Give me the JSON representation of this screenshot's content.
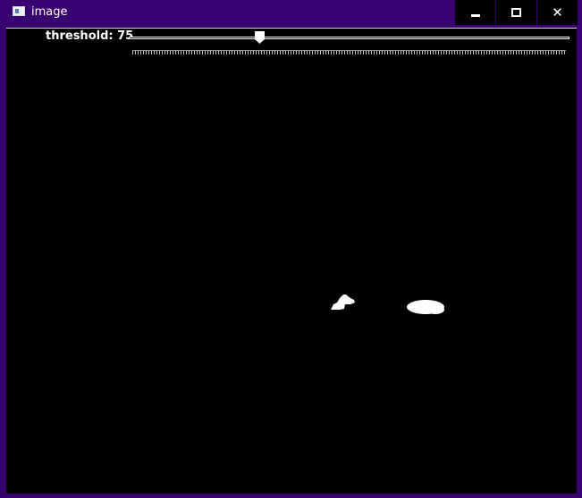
{
  "window": {
    "title": "image",
    "app_icon": "window-app-icon",
    "controls": {
      "minimize_icon": "minimize-icon",
      "maximize_icon": "maximize-icon",
      "close_icon": "close-icon",
      "close_glyph": "✕"
    },
    "colors": {
      "frame": "#39006f",
      "titlebar_buttons": "#000000",
      "canvas": "#000000",
      "foreground": "#ffffff"
    }
  },
  "trackbar": {
    "label": "threshold: 75",
    "value": 75,
    "min": 0,
    "max": 255
  }
}
